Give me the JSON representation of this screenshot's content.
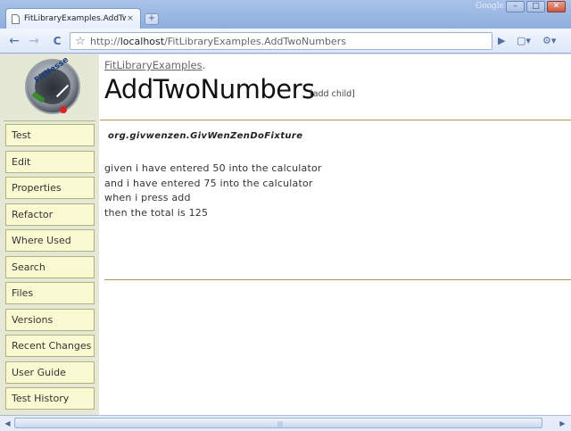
{
  "browser": {
    "tab_title": "FitLibraryExamples.AddTwo...",
    "tab_close": "×",
    "new_tab": "+",
    "brand": "Google",
    "window_controls": {
      "minimize": "–",
      "maximize": "□",
      "close": "✕"
    },
    "nav": {
      "back": "←",
      "forward": "→",
      "reload": "C",
      "bookmark": "☆"
    },
    "url_prefix": "http://",
    "url_host": "localhost",
    "url_path": "/FitLibraryExamples.AddTwoNumbers",
    "go": "▶",
    "page_menu": "▢▾",
    "tools_menu": "⚙▾"
  },
  "logo": {
    "text": "FitNesse"
  },
  "sidebar": {
    "items": [
      {
        "label": "Test"
      },
      {
        "label": "Edit"
      },
      {
        "label": "Properties"
      },
      {
        "label": "Refactor"
      },
      {
        "label": "Where Used"
      },
      {
        "label": "Search"
      },
      {
        "label": "Files"
      },
      {
        "label": "Versions"
      },
      {
        "label": "Recent Changes"
      },
      {
        "label": "User Guide"
      },
      {
        "label": "Test History"
      }
    ]
  },
  "main": {
    "breadcrumb_link": "FitLibraryExamples",
    "breadcrumb_sep": ".",
    "title": "AddTwoNumbers",
    "add_child": "[add child]",
    "fixture": "org.givwenzen.GivWenZenDoFixture",
    "steps": [
      "given i have entered 50 into the calculator",
      "and i have entered 75 into the calculator",
      "when i press add",
      "then the total is 125"
    ]
  },
  "scrollbar": {
    "left": "◀",
    "right": "▶",
    "grip": "|||"
  }
}
